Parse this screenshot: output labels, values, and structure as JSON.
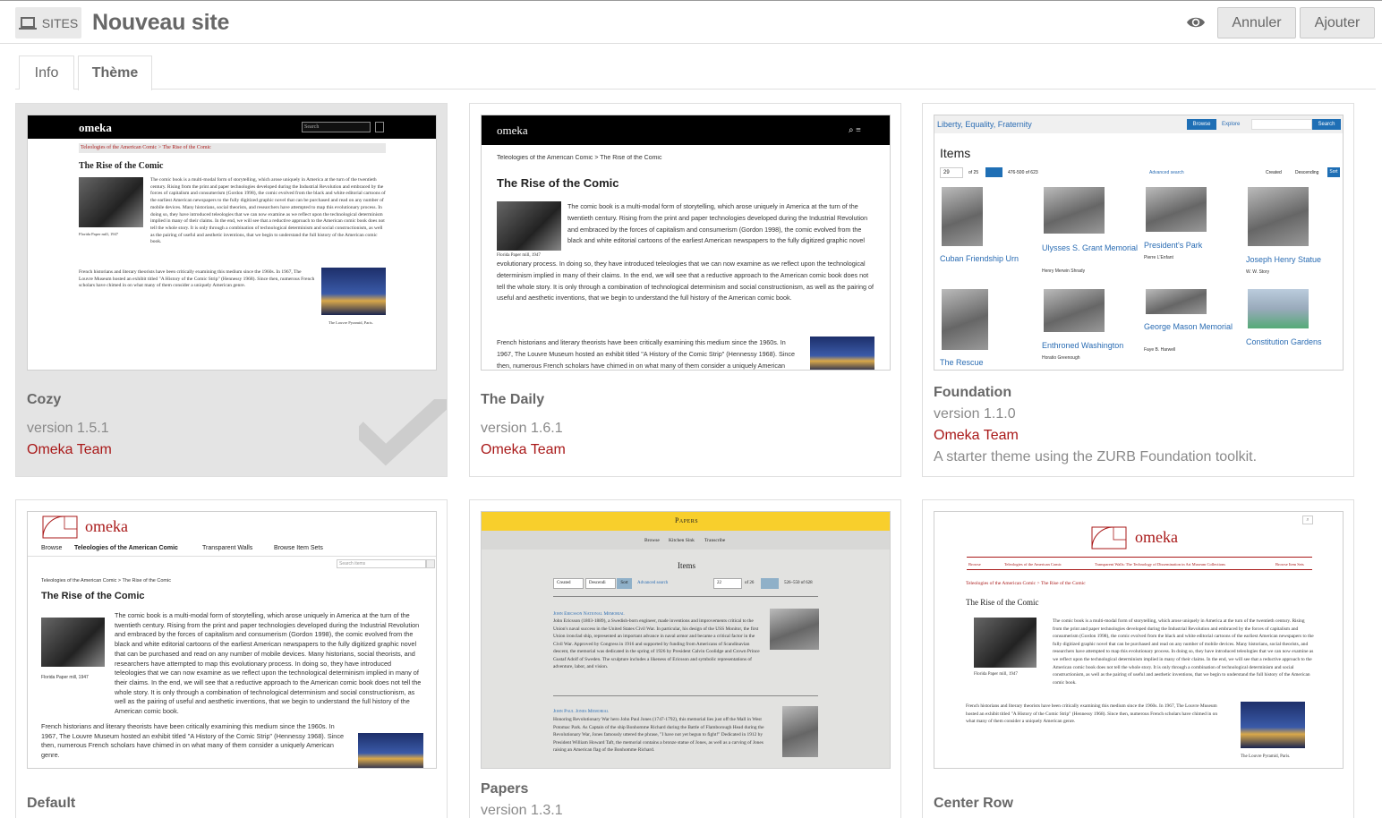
{
  "header": {
    "sites_label": "SITES",
    "title": "Nouveau site",
    "cancel_label": "Annuler",
    "add_label": "Ajouter"
  },
  "tabs": [
    {
      "label": "Info"
    },
    {
      "label": "Thème"
    }
  ],
  "themes": [
    {
      "name": "Cozy",
      "version": "version 1.5.1",
      "author": "Omeka Team",
      "selected": true
    },
    {
      "name": "The Daily",
      "version": "version 1.6.1",
      "author": "Omeka Team"
    },
    {
      "name": "Foundation",
      "version": "version 1.1.0",
      "author": "Omeka Team",
      "description": "A starter theme using the ZURB Foundation toolkit."
    },
    {
      "name": "Default"
    },
    {
      "name": "Papers",
      "version": "version 1.3.1"
    },
    {
      "name": "Center Row"
    }
  ],
  "previews": {
    "logo": "omeka",
    "breadcrumb": "Teleologies of the American Comic > The Rise of the Comic",
    "article_title": "The Rise of the Comic",
    "caption_paper": "Florida Paper mill, 1947",
    "caption_louvre": "The Louvre Pyramid, Paris.",
    "search_placeholder": "Search",
    "paragraph1": "The comic book is a multi-modal form of storytelling, which arose uniquely in America at the turn of the twentieth century. Rising from the print and paper technologies developed during the Industrial Revolution and embraced by the forces of capitalism and consumerism (Gordon 1998), the comic evolved from the black and white editorial cartoons of the earliest American newspapers to the fully digitized graphic novel that can be purchased and read on any number of mobile devices. Many historians, social theorists, and researchers have attempted to map this evolutionary process. In doing so, they have introduced teleologies that we can now examine as we reflect upon the technological determinism implied in many of their claims. In the end, we will see that a reductive approach to the American comic book does not tell the whole story. It is only through a combination of technological determinism and social constructionism, as well as the pairing of useful and aesthetic inventions, that we begin to understand the full history of the American comic book.",
    "paragraph2": "French historians and literary theorists have been critically examining this medium since the 1960s. In 1967, The Louvre Museum hosted an exhibit titled \"A History of the Comic Strip\" (Hennessy 1968). Since then, numerous French scholars have chimed in on what many of them consider a uniquely American genre.",
    "foundation": {
      "site_title": "Liberty, Equality, Fraternity",
      "browse": "Browse",
      "explore": "Explore",
      "search_btn": "Search",
      "items_heading": "Items",
      "page": "29",
      "of_pages": "of 25",
      "range": "476-500 of 623",
      "advanced": "Advanced search",
      "sort_created": "Created",
      "sort_desc": "Descending",
      "sort_btn": "Sort",
      "items": [
        {
          "title": "Cuban Friendship Urn",
          "creator": ""
        },
        {
          "title": "Ulysses S. Grant Memorial",
          "creator": "Henry Merwin Shrady"
        },
        {
          "title": "President's Park",
          "creator": "Pierre L'Enfant"
        },
        {
          "title": "Joseph Henry Statue",
          "creator": "W. W. Story"
        },
        {
          "title": "The Rescue",
          "creator": ""
        },
        {
          "title": "Enthroned Washington",
          "creator": "Horatio Greenough"
        },
        {
          "title": "George Mason Memorial",
          "creator": "Faye B. Harwell"
        },
        {
          "title": "Constitution Gardens",
          "creator": ""
        }
      ]
    },
    "default_nav": [
      "Browse",
      "Teleologies of the American Comic",
      "Transparent Walls",
      "Browse Item Sets"
    ],
    "default_search": "Search items",
    "papers": {
      "title": "Papers",
      "nav": [
        "Browse",
        "Kitchen Sink",
        "Transcribe"
      ],
      "items_heading": "Items",
      "sort_created": "Created",
      "sort_desc": "Descendi",
      "sort_btn": "Sort",
      "advanced": "Advanced search",
      "page": "22",
      "of_pages": "of 26",
      "range": "526–550 of 628",
      "entry1_title": "John Ericsson National Memorial",
      "entry1_text": "John Ericsson (1803-1889), a Swedish-born engineer, made inventions and improvements critical to the Union's naval success in the United States Civil War. In particular, his design of the USS Monitor, the first Union ironclad ship, represented an important advance in naval armor and became a critical factor in the Civil War. Approved by Congress in 1916 and supported by funding from Americans of Scandinavian descent, the memorial was dedicated in the spring of 1926 by President Calvin Coolidge and Crown Prince Gustaf Adolf of Sweden. The sculpture includes a likeness of Ericsson and symbolic representations of adventure, labor, and vision.",
      "entry2_title": "John Paul Jones Memorial",
      "entry2_text": "Honoring Revolutionary War hero John Paul Jones (1747-1792), this memorial lies just off the Mall in West Potomac Park. As Captain of the ship Bonhomme Richard during the Battle of Flamborough Head during the Revolutionary War, Jones famously uttered the phrase, \"I have not yet begun to fight!\" Dedicated in 1912 by President William Howard Taft, the memorial contains a bronze statue of Jones, as well as a carving of Jones raising an American flag of the Bonhomme Richard."
    },
    "center_nav": [
      "Browse",
      "Teleologies of the American Comic",
      "Transparent Walls: The Technology of Dissemination in Art Museum Collections",
      "Browse Item Sets"
    ]
  }
}
